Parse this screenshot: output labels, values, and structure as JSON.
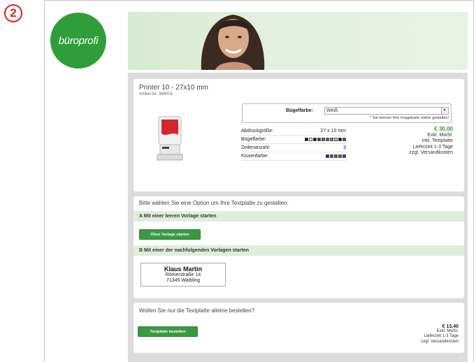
{
  "step_number": "2",
  "logo_text": "büroprofi",
  "product": {
    "title": "Printer 10 - 27x10 mm",
    "article_no": "Artikel-Nr. 386001"
  },
  "color_select": {
    "label": "Bügelfarbe:",
    "value": "Weiß",
    "note": "* Sie können Ihre Imagekarte online gestalten!"
  },
  "specs": [
    {
      "label": "Abdruckgröße:",
      "value": "27 x 10 mm"
    },
    {
      "label": "Bügelfarbe:",
      "value": ""
    },
    {
      "label": "Zeilenanzahl:",
      "value": "3"
    },
    {
      "label": "Kissenfarbe:",
      "value": ""
    }
  ],
  "colors": {
    "accent_green": "#2f9e3a",
    "section_bar": "#e0eddb",
    "frame_swatches": [
      "#111111",
      "#ffffff",
      "#1a1a1a",
      "#2b3fa8",
      "#d11b1b",
      "#1b8a2e",
      "#777777",
      "#e6d21a",
      "#0d0d0d",
      "#3355aa"
    ],
    "pad_swatches": [
      "#1a237e",
      "#1565c0",
      "#c62828",
      "#2e7d32",
      "#6a1b9a"
    ]
  },
  "price": {
    "amount": "€ 30,00",
    "line1": "Exkl. MwSt.",
    "line2": "inkl. Textplatte",
    "line3": "Lieferzeit 1-3 Tage",
    "line4": "zzgl. Versandkosten"
  },
  "options": {
    "heading": "Bitte wählen Sie eine Option um Ihre Textplatte zu gestalten:",
    "option_a": "A Mit einer leeren Vorlage starten",
    "button_start": "Ohne Vorlage starten",
    "option_b": "B Mit einer der nachfolgenden Vorlagen starten",
    "template": {
      "name": "Klaus Martin",
      "line1": "Römerstraße 14",
      "line2": "71345 Waibling"
    }
  },
  "plate": {
    "heading": "Wollen Sie nur die Textplatte alleine bestellen?",
    "button": "Textplatte bestellen",
    "price": "€ 13,40",
    "line1": "Exkl. MwSt.",
    "line2": "Lieferzeit 1-3 Tage",
    "line3": "zzgl. Versandkosten"
  }
}
